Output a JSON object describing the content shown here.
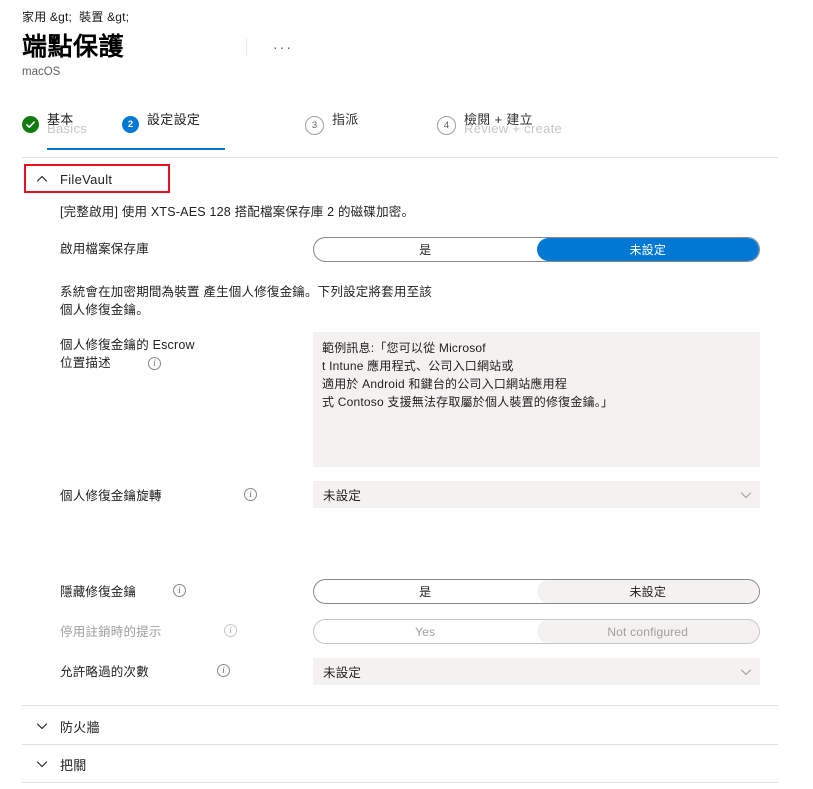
{
  "breadcrumb": "家用 &gt;  裝置 &gt;",
  "header": {
    "title": "端點保護",
    "subtitle": "macOS",
    "more_label": "···"
  },
  "steps": [
    {
      "badge": "check",
      "cn": "基本",
      "en": "Basics",
      "state": "done"
    },
    {
      "badge": "2",
      "cn": "設定設定",
      "en": "",
      "state": "active"
    },
    {
      "badge": "3",
      "cn": "指派",
      "en": "",
      "state": "idle"
    },
    {
      "badge": "4",
      "cn": "檢閱 + 建立",
      "en": "Review + create",
      "state": "idle"
    }
  ],
  "filevault": {
    "section_label": "FileVault",
    "description": "[完整啟用]  使用 XTS-AES 128 搭配檔案保存庫  2 的磁碟加密。",
    "enable_label": "啟用檔案保存庫",
    "enable_options": [
      "是",
      "未設定"
    ],
    "enable_selected": 1,
    "note_line1": "系統會在加密期間為裝置 產生個人修復金鑰。下列設定將套用至該",
    "note_line2": "個人修復金鑰。",
    "escrow_label_line1": "個人修復金鑰的 Escrow",
    "escrow_label_line2": "位置描述",
    "escrow_value": "範例訊息:「您可以從 Microsof\nt Intune 應用程式、公司入口網站或\n適用於 Android 和鍵台的公司入口網站應用程\n式 Contoso 支援無法存取屬於個人裝置的修復金鑰。」",
    "rotation_label": "個人修復金鑰旋轉",
    "rotation_value": "未設定",
    "hide_key_label": "隱藏修復金鑰",
    "hide_key_options": [
      "是",
      "未設定"
    ],
    "hide_key_selected": 1,
    "deferral_prompt_label": "停用註銷時的提示",
    "deferral_prompt_options": [
      "Yes",
      "Not configured"
    ],
    "deferral_prompt_selected": 1,
    "skip_count_label": "允許略過的次數",
    "skip_count_value": "未設定"
  },
  "collapsed_sections": [
    {
      "label": "防火牆"
    },
    {
      "label": "把關"
    }
  ],
  "colors": {
    "accent": "#0078d4",
    "success": "#107c10",
    "highlight": "#e81123",
    "neutral_fill": "#f3f2f1"
  }
}
